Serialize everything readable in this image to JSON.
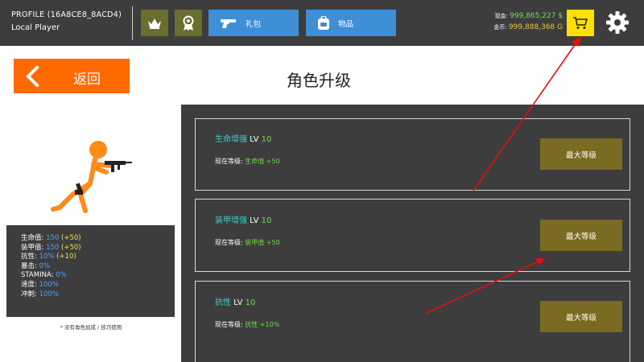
{
  "header": {
    "profile_name": "PROFILE (16A8CE8_8ACD4)",
    "player_name": "Local Player",
    "gift_label": "礼包",
    "items_label": "物品",
    "cash_label": "现金:",
    "cash_value": "999,865,227 $",
    "gold_label": "金币:",
    "gold_value": "999,888,368 G"
  },
  "nav": {
    "back_label": "返回",
    "page_title": "角色升级"
  },
  "stats": [
    {
      "label": "生命值: ",
      "value": "150",
      "bonus": " (+50)"
    },
    {
      "label": "装甲值: ",
      "value": "150",
      "bonus": " (+50)"
    },
    {
      "label": "抗性: ",
      "value": "10%",
      "bonus": " (+10)"
    },
    {
      "label": "暴击: ",
      "value": "0%",
      "bonus": ""
    },
    {
      "label": "STAMINA: ",
      "value": "0%",
      "bonus": ""
    },
    {
      "label": "速度: ",
      "value": "100%",
      "bonus": ""
    },
    {
      "label": "冲刺: ",
      "value": "100%",
      "bonus": ""
    }
  ],
  "footnote": "* 没有角色加成 / 技巧使用",
  "upgrades": [
    {
      "name": "生命增强",
      "lv_label": " LV ",
      "level": "10",
      "desc_prefix": "现在等级: ",
      "desc_value": "生命值 +50",
      "button": "最大等级"
    },
    {
      "name": "装甲增强",
      "lv_label": " LV ",
      "level": "10",
      "desc_prefix": "现在等级: ",
      "desc_value": "装甲值 +50",
      "button": "最大等级"
    },
    {
      "name": "抗性",
      "lv_label": " LV ",
      "level": "10",
      "desc_prefix": "现在等级: ",
      "desc_value": "抗性 +10%",
      "button": "最大等级"
    }
  ],
  "icons": {
    "rank": "crown-icon",
    "achievements": "medal-icon",
    "gift": "pistol-icon",
    "items": "backpack-icon",
    "shop": "cart-icon",
    "settings": "gear-icon",
    "back": "chevron-left-icon"
  },
  "colors": {
    "accent_orange": "#ff6a00",
    "topbar": "#3d3d3d",
    "blue_button": "#3e8fd6",
    "olive_button": "#6b6e2e",
    "max_button": "#7b6a21",
    "cart_button": "#ffe000",
    "cash_green": "#6fe05a",
    "gold_yellow": "#e8c53a",
    "stat_blue": "#4aa3ff",
    "name_cyan": "#3fd0c8",
    "annotation_red": "#e01010"
  }
}
